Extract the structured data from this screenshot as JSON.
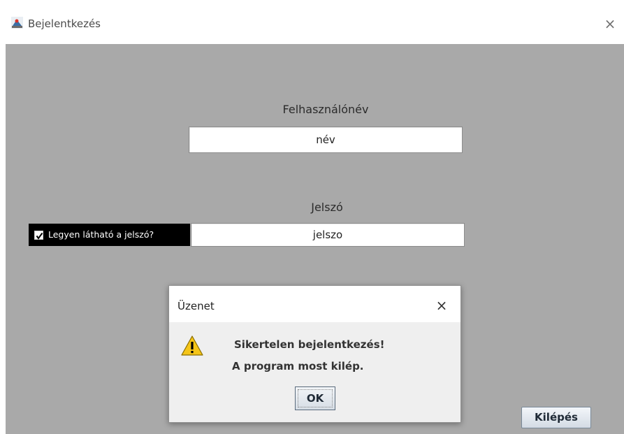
{
  "window": {
    "title": "Bejelentkezés",
    "close_glyph": "×",
    "icon": "java-app-icon"
  },
  "form": {
    "username_label": "Felhasználónév",
    "username_value": "név",
    "password_label": "Jelszó",
    "password_value": "jelszo",
    "show_password_label": "Legyen látható a jelszó?",
    "show_password_checked": true,
    "exit_button": "Kilépés"
  },
  "dialog": {
    "title": "Üzenet",
    "close_glyph": "×",
    "icon": "warning-icon",
    "message_line1": "Sikertelen bejelentkezés!",
    "message_line2": "A program most kilép.",
    "ok_label": "OK"
  },
  "colors": {
    "content_bg": "#a9a9a9",
    "checkbox_bg": "#000000",
    "warning_yellow": "#f5c518"
  }
}
